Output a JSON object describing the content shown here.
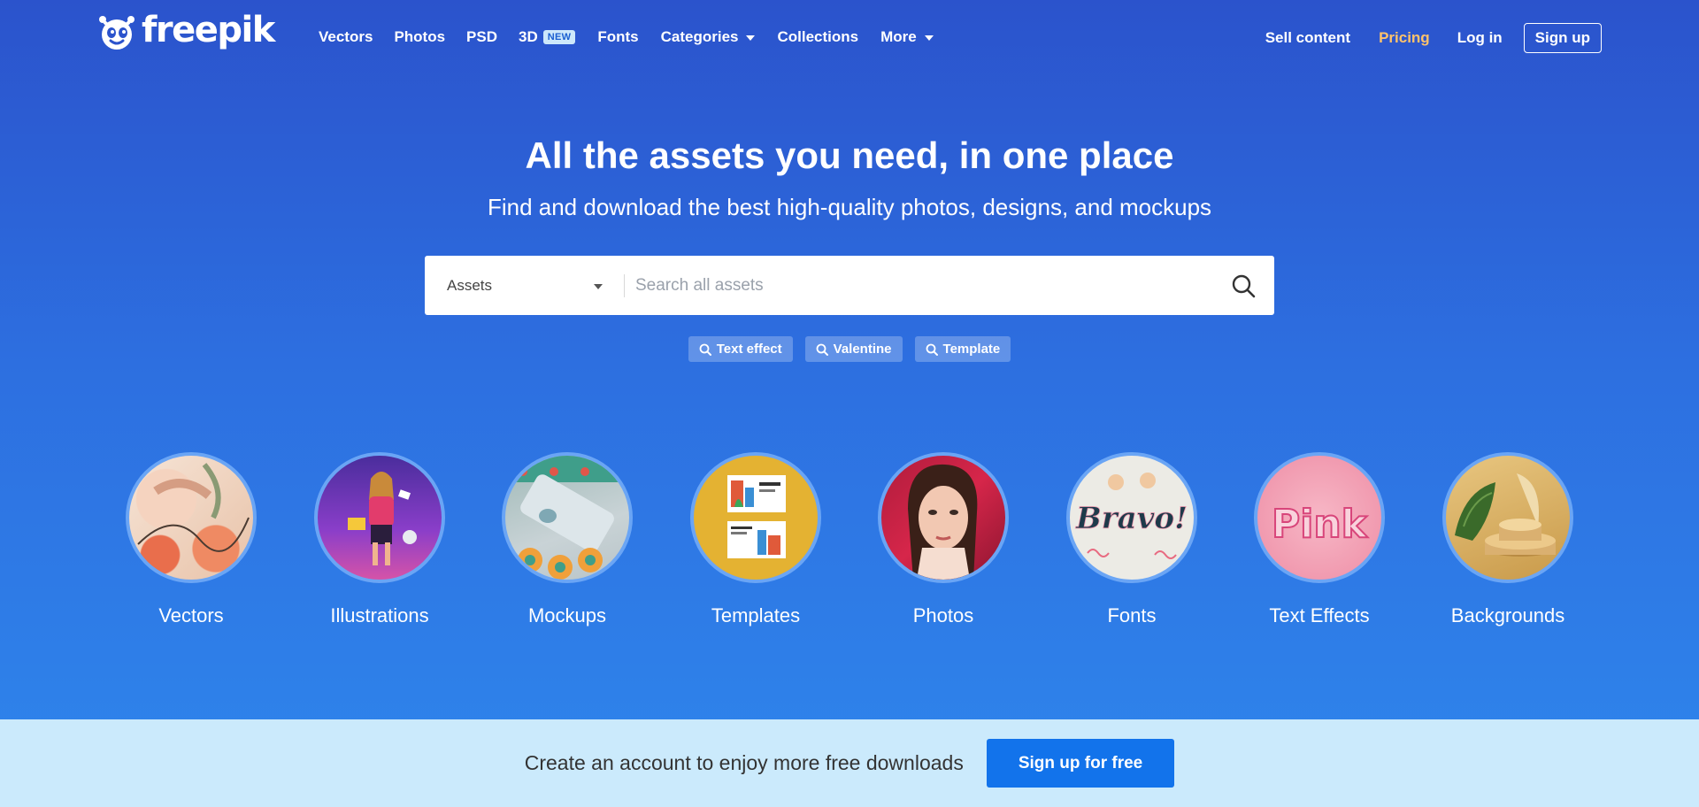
{
  "brand": {
    "name": "freepik"
  },
  "nav": {
    "left": [
      {
        "label": "Vectors"
      },
      {
        "label": "Photos"
      },
      {
        "label": "PSD"
      },
      {
        "label": "3D",
        "badge": "NEW"
      },
      {
        "label": "Fonts"
      },
      {
        "label": "Categories",
        "dropdown": true
      },
      {
        "label": "Collections"
      },
      {
        "label": "More",
        "dropdown": true
      }
    ],
    "sell": "Sell content",
    "pricing": "Pricing",
    "login": "Log in",
    "signup": "Sign up"
  },
  "hero": {
    "title": "All the assets you need, in one place",
    "subtitle": "Find and download the best high-quality photos, designs, and mockups"
  },
  "search": {
    "type_value": "Assets",
    "placeholder": "Search all assets",
    "value": "",
    "icon": "search-icon"
  },
  "tags": [
    "Text effect",
    "Valentine",
    "Template"
  ],
  "categories": [
    {
      "label": "Vectors",
      "icon": "vectors-thumb"
    },
    {
      "label": "Illustrations",
      "icon": "illustrations-thumb"
    },
    {
      "label": "Mockups",
      "icon": "mockups-thumb"
    },
    {
      "label": "Templates",
      "icon": "templates-thumb"
    },
    {
      "label": "Photos",
      "icon": "photos-thumb"
    },
    {
      "label": "Fonts",
      "icon": "fonts-thumb",
      "thumb_text": "Bravo!"
    },
    {
      "label": "Text Effects",
      "icon": "text-effects-thumb",
      "thumb_text": "Pink"
    },
    {
      "label": "Backgrounds",
      "icon": "backgrounds-thumb"
    }
  ],
  "banner": {
    "text": "Create an account to enjoy more free downloads",
    "button": "Sign up for free"
  },
  "colors": {
    "background_top": "#2b53cc",
    "background_bottom": "#2f86ec",
    "pricing": "#ffc36b",
    "banner": "#cbeafc",
    "primary_button": "#1273eb"
  }
}
